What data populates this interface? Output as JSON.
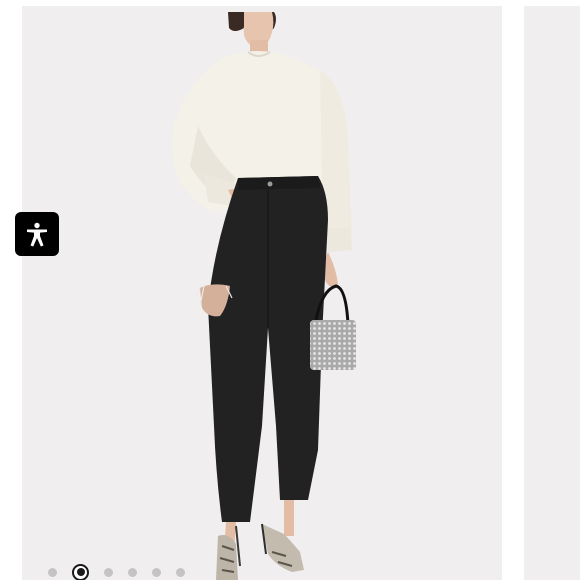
{
  "carousel": {
    "slide_count": 6,
    "active_index": 1
  },
  "accessibility": {
    "icon": "accessibility-person-icon"
  },
  "product_image": {
    "top": "white-sweater",
    "bottom": "black-distressed-jeans",
    "accessory": "crystal-mesh-handbag",
    "shoes": "snakeskin-heels"
  },
  "colors": {
    "slide_background": "#f0eeef",
    "sweater": "#f4f1e8",
    "jeans": "#232222",
    "dot_inactive": "#c4c4c4",
    "dot_active": "#1a1a1a",
    "accessibility_bg": "#000000"
  }
}
